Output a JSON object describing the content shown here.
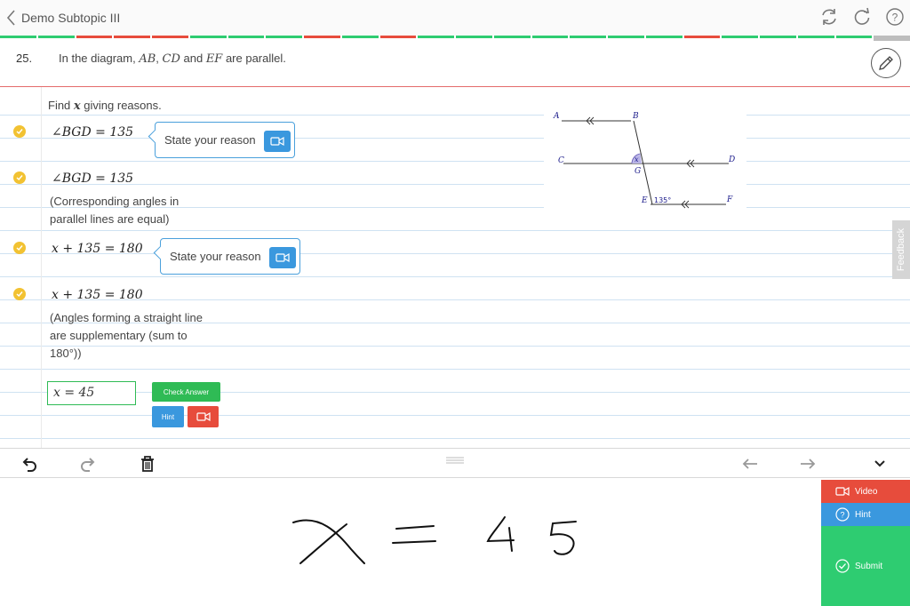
{
  "header": {
    "title": "Demo Subtopic III"
  },
  "progress": {
    "segments": [
      "green",
      "green",
      "red",
      "red",
      "red",
      "green",
      "green",
      "green",
      "red",
      "green",
      "red",
      "green",
      "green",
      "green",
      "green",
      "green",
      "green",
      "green",
      "red",
      "green",
      "green",
      "green",
      "green",
      "grey"
    ],
    "colors": {
      "green": "#2ecc71",
      "red": "#e74c3c",
      "grey": "#bdbdbd"
    }
  },
  "question": {
    "number": "25.",
    "intro": "In the diagram, ",
    "v1": "AB",
    "sep1": ", ",
    "v2": "CD",
    "sep2": " and ",
    "v3": "EF",
    "tail": " are parallel."
  },
  "work": {
    "prompt_pre": "Find ",
    "prompt_var": "x",
    "prompt_post": " giving reasons.",
    "step1": "∠BGD = 135",
    "step1_reason_placeholder": "State your reason",
    "step2": "∠BGD = 135",
    "step2_reason_line1": "(Corresponding angles in",
    "step2_reason_line2": "parallel lines are equal)",
    "step3": "x + 135 = 180",
    "step3_reason_placeholder": "State your reason",
    "step4": "x + 135 = 180",
    "step4_reason_line1": "(Angles forming a straight line",
    "step4_reason_line2": "are supplementary (sum to",
    "step4_reason_line3": "180°))",
    "answer_value": "x = 45",
    "check_answer_label": "Check Answer",
    "hint_label": "Hint"
  },
  "diagram": {
    "labels": {
      "A": "A",
      "B": "B",
      "C": "C",
      "D": "D",
      "E": "E",
      "F": "F",
      "G": "G",
      "x": "x",
      "angle": "135°"
    }
  },
  "feedback_label": "Feedback",
  "handwriting": {
    "text": "x = 45"
  },
  "side_panel": {
    "video_label": "Video",
    "hint_label": "Hint",
    "submit_label": "Submit"
  },
  "colors": {
    "accent_blue": "#3a98de",
    "green": "#2ecc71",
    "red": "#e74c3c",
    "check_yellow": "#f2c232"
  }
}
